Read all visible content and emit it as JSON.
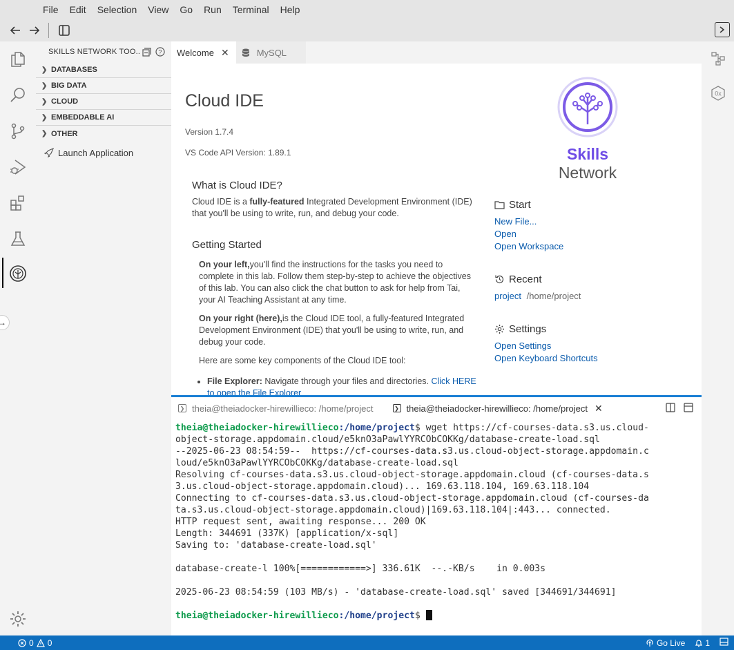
{
  "menu": [
    "File",
    "Edit",
    "Selection",
    "View",
    "Go",
    "Run",
    "Terminal",
    "Help"
  ],
  "toolbar": {
    "back_icon": "arrow-left-icon",
    "forward_icon": "arrow-right-icon",
    "layout_icon": "toggle-panel-icon",
    "right_icon": "toggle-secondary-bar-icon"
  },
  "activity_bar": [
    "explorer-icon",
    "search-icon",
    "source-control-icon",
    "run-debug-icon",
    "extensions-icon",
    "test-beaker-icon",
    "skills-network-icon",
    "settings-gear-icon"
  ],
  "sidebar": {
    "title": "SKILLS NETWORK TOO...",
    "sections": [
      "DATABASES",
      "BIG DATA",
      "CLOUD",
      "EMBEDDABLE AI",
      "OTHER"
    ],
    "launch": "Launch Application"
  },
  "tabs": [
    {
      "label": "Welcome",
      "active": true
    },
    {
      "label": "MySQL",
      "active": false
    }
  ],
  "welcome": {
    "title": "Cloud IDE",
    "version": "Version 1.7.4",
    "api_version": "VS Code API Version: 1.89.1",
    "what_heading": "What is Cloud IDE?",
    "what_pre": "Cloud IDE is a ",
    "what_bold": "fully-featured",
    "what_post": " Integrated Development Environment (IDE) that you'll be using to write, run, and debug your code.",
    "getting_started": "Getting Started",
    "left_bold": "On your left,",
    "left_text": "you'll find the instructions for the tasks you need to complete in this lab. Follow them step-by-step to achieve the objectives of this lab. You can also click the chat button to ask for help from Tai, your AI Teaching Assistant at any time.",
    "right_bold": "On your right (here),",
    "right_text": "is the Cloud IDE tool, a fully-featured Integrated Development Environment (IDE) that you'll be using to write, run, and debug your code.",
    "key_components": "Here are some key components of the Cloud IDE tool:",
    "bullet_bold": "File Explorer:",
    "bullet_text": " Navigate through your files and directories. ",
    "bullet_link": "Click HERE to open the File Explorer",
    "logo_top": "Skills",
    "logo_bottom": "Network",
    "start": {
      "heading": "Start",
      "links": [
        "New File...",
        "Open",
        "Open Workspace"
      ]
    },
    "recent": {
      "heading": "Recent",
      "project_link": "project",
      "project_path": "/home/project"
    },
    "settings": {
      "heading": "Settings",
      "links": [
        "Open Settings",
        "Open Keyboard Shortcuts"
      ]
    }
  },
  "terminal": {
    "tabs": [
      {
        "label": "theia@theiadocker-hirewillieco: /home/project",
        "active": false
      },
      {
        "label": "theia@theiadocker-hirewillieco: /home/project",
        "active": true
      }
    ],
    "prompt_user": "theia@theiadocker-hirewillieco",
    "prompt_path": ":/home/project",
    "prompt_sign": "$ ",
    "command_line1": "wget https://cf-courses-data.s3.us.cloud-",
    "output": [
      "object-storage.appdomain.cloud/e5knO3aPawlYYRCObCOKKg/database-create-load.sql",
      "--2025-06-23 08:54:59--  https://cf-courses-data.s3.us.cloud-object-storage.appdomain.c",
      "loud/e5knO3aPawlYYRCObCOKKg/database-create-load.sql",
      "Resolving cf-courses-data.s3.us.cloud-object-storage.appdomain.cloud (cf-courses-data.s",
      "3.us.cloud-object-storage.appdomain.cloud)... 169.63.118.104, 169.63.118.104",
      "Connecting to cf-courses-data.s3.us.cloud-object-storage.appdomain.cloud (cf-courses-da",
      "ta.s3.us.cloud-object-storage.appdomain.cloud)|169.63.118.104|:443... connected.",
      "HTTP request sent, awaiting response... 200 OK",
      "Length: 344691 (337K) [application/x-sql]",
      "Saving to: 'database-create-load.sql'",
      "",
      "database-create-l 100%[============>] 336.61K  --.-KB/s    in 0.003s",
      "",
      "2025-06-23 08:54:59 (103 MB/s) - 'database-create-load.sql' saved [344691/344691]",
      ""
    ]
  },
  "status": {
    "errors": "0",
    "warnings": "0",
    "go_live": "Go Live",
    "notifications": "1"
  },
  "colors": {
    "accent": "#0e6ebe",
    "link": "#0b5cad",
    "brand": "#6f4de6",
    "prompt_user": "#0c9a4b",
    "prompt_path": "#1f3f8a"
  }
}
